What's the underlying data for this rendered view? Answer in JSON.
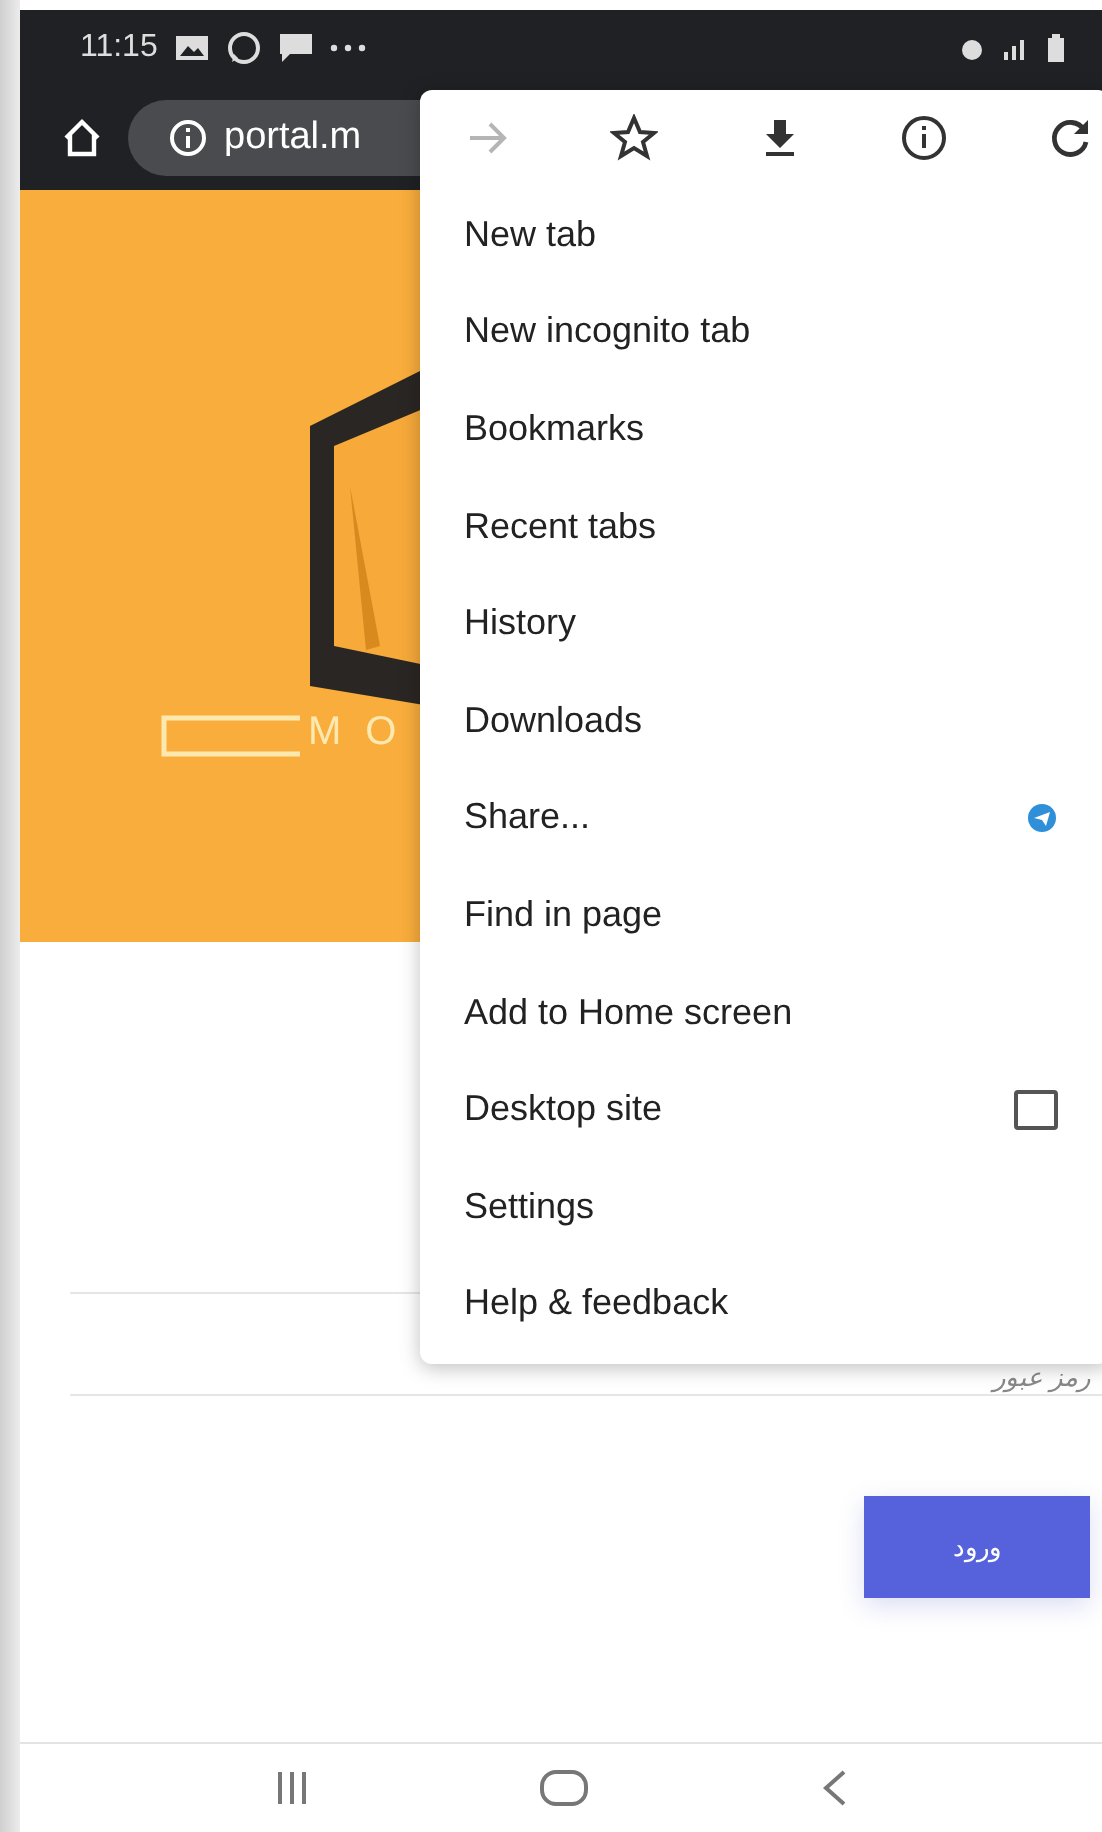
{
  "status_bar": {
    "time": "11:15"
  },
  "address_bar": {
    "url": "portal.m"
  },
  "banner": {
    "logo_text": "MO"
  },
  "form": {
    "password_placeholder": "رمز عبور",
    "login_button": "ورود"
  },
  "menu": {
    "toolbar": [
      {
        "kind": "forward",
        "disabled": true
      },
      {
        "kind": "bookmark",
        "disabled": false
      },
      {
        "kind": "download",
        "disabled": false
      },
      {
        "kind": "info",
        "disabled": false
      },
      {
        "kind": "reload",
        "disabled": false
      }
    ],
    "items": [
      {
        "kind": "plain",
        "label": "New tab"
      },
      {
        "kind": "plain",
        "label": "New incognito tab"
      },
      {
        "kind": "plain",
        "label": "Bookmarks"
      },
      {
        "kind": "plain",
        "label": "Recent tabs"
      },
      {
        "kind": "plain",
        "label": "History"
      },
      {
        "kind": "plain",
        "label": "Downloads"
      },
      {
        "kind": "share",
        "label": "Share..."
      },
      {
        "kind": "plain",
        "label": "Find in page"
      },
      {
        "kind": "plain",
        "label": "Add to Home screen"
      },
      {
        "kind": "checkbox",
        "label": "Desktop site",
        "checked": false
      },
      {
        "kind": "plain",
        "label": "Settings"
      },
      {
        "kind": "plain",
        "label": "Help & feedback"
      }
    ]
  }
}
